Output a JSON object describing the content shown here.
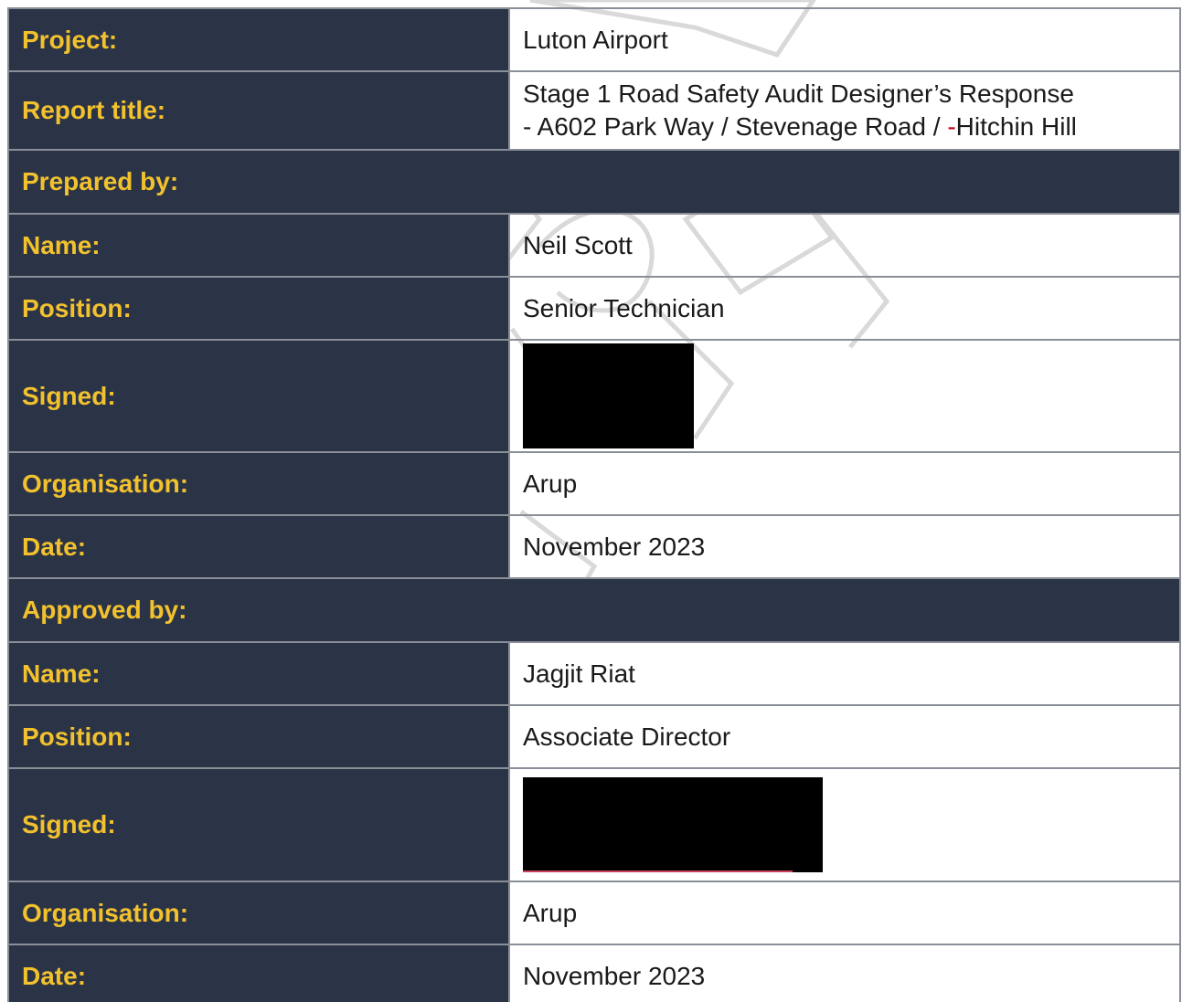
{
  "rows": {
    "project": {
      "label": "Project:",
      "value": "Luton Airport"
    },
    "report_title": {
      "label": "Report title:",
      "line1": "Stage 1 Road Safety Audit Designer’s Response",
      "line2_prefix": "- A602 Park Way / Stevenage Road / ",
      "line2_strike": "-",
      "line2_suffix": "Hitchin Hill"
    },
    "prepared_by": {
      "heading": "Prepared by:",
      "name_label": "Name:",
      "name": "Neil Scott",
      "position_label": "Position:",
      "position": "Senior Technician",
      "signed_label": "Signed:",
      "organisation_label": "Organisation:",
      "organisation": "Arup",
      "date_label": "Date:",
      "date": "November 2023"
    },
    "approved_by": {
      "heading": "Approved by:",
      "name_label": "Name:",
      "name": "Jagjit Riat",
      "position_label": "Position:",
      "position": "Associate Director",
      "signed_label": "Signed:",
      "organisation_label": "Organisation:",
      "organisation": "Arup",
      "date_label": "Date:",
      "date": "November 2023"
    }
  },
  "colors": {
    "label_bg": "#2b3447",
    "label_text": "#f2c12e",
    "redaction": "#000000"
  }
}
